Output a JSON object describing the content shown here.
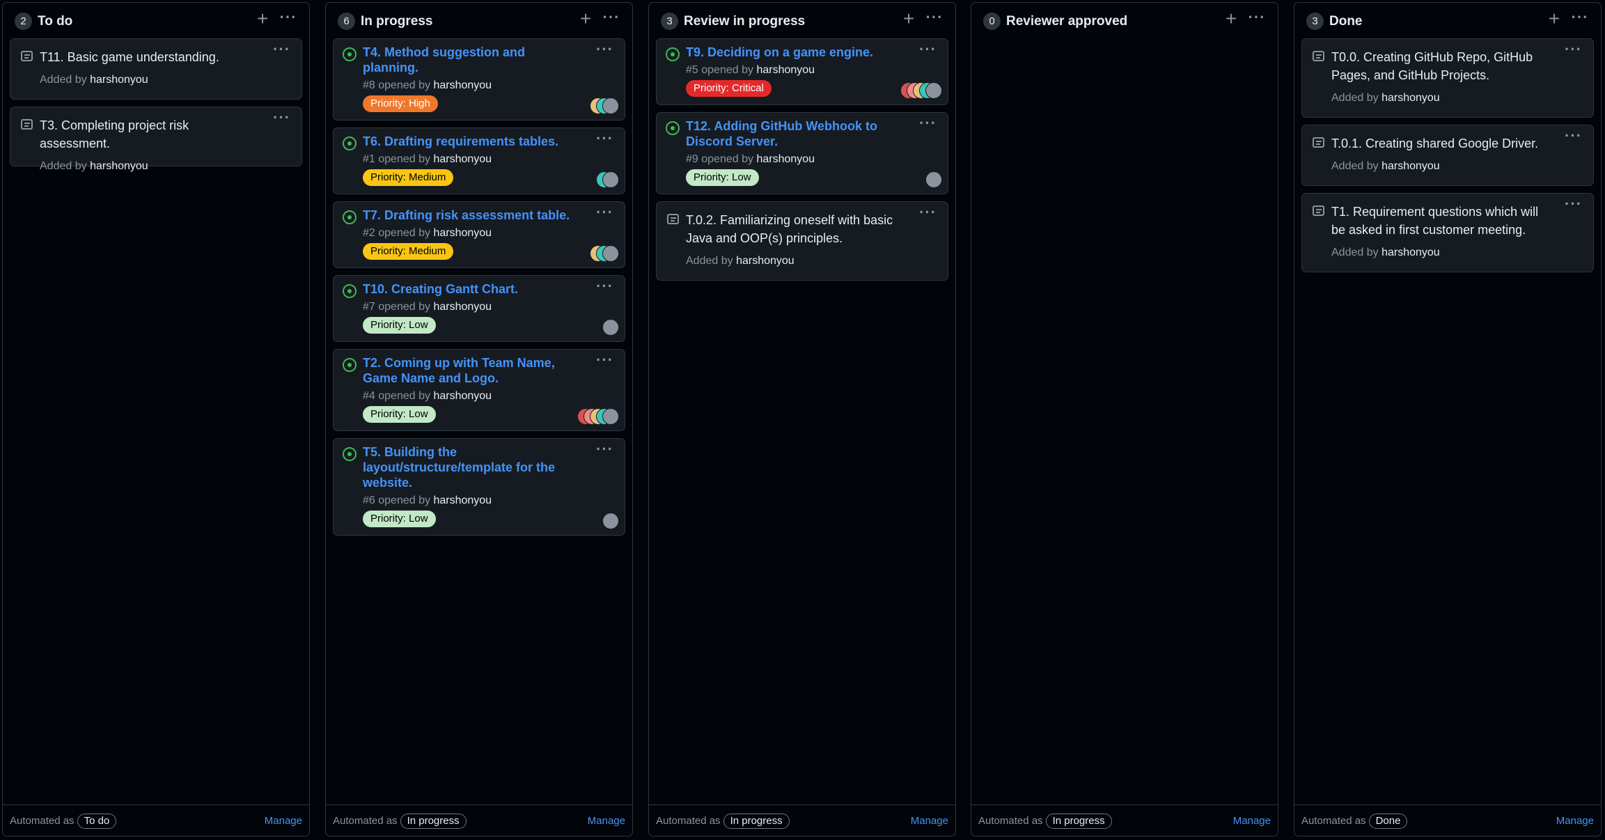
{
  "columns": [
    {
      "count": "2",
      "title": "To do",
      "footer": {
        "automated_prefix": "Automated as",
        "automated_value": "To do",
        "manage": "Manage"
      },
      "cards": [
        {
          "text": "T11. Basic game understanding.",
          "added_by_prefix": "Added by",
          "author": "harshonyou"
        },
        {
          "text": "T3. Completing project risk assessment.",
          "added_by_prefix": "Added by",
          "author": "harshonyou"
        }
      ]
    },
    {
      "count": "6",
      "title": "In progress",
      "footer": {
        "automated_prefix": "Automated as",
        "automated_value": "In progress",
        "manage": "Manage"
      },
      "issues": [
        {
          "title": "T4. Method suggestion and planning.",
          "number_text": "#8 opened by",
          "author": "harshonyou",
          "label": "Priority: High",
          "label_bg": "#f0782a",
          "label_fg": "#ffffff",
          "avatars": 3
        },
        {
          "title": "T6. Drafting requirements tables.",
          "number_text": "#1 opened by",
          "author": "harshonyou",
          "label": "Priority: Medium",
          "label_bg": "#f9c513",
          "label_fg": "#000000",
          "avatars": 2
        },
        {
          "title": "T7. Drafting risk assessment table.",
          "number_text": "#2 opened by",
          "author": "harshonyou",
          "label": "Priority: Medium",
          "label_bg": "#f9c513",
          "label_fg": "#000000",
          "avatars": 3
        },
        {
          "title": "T10. Creating Gantt Chart.",
          "number_text": "#7 opened by",
          "author": "harshonyou",
          "label": "Priority: Low",
          "label_bg": "#c2e8c6",
          "label_fg": "#000000",
          "avatars": 1
        },
        {
          "title": "T2. Coming up with Team Name, Game Name and Logo.",
          "number_text": "#4 opened by",
          "author": "harshonyou",
          "label": "Priority: Low",
          "label_bg": "#c2e8c6",
          "label_fg": "#000000",
          "avatars": 5
        },
        {
          "title": "T5. Building the layout/structure/template for the website.",
          "number_text": "#6 opened by",
          "author": "harshonyou",
          "label": "Priority: Low",
          "label_bg": "#c2e8c6",
          "label_fg": "#000000",
          "avatars": 1
        }
      ]
    },
    {
      "count": "3",
      "title": "Review in progress",
      "footer": {
        "automated_prefix": "Automated as",
        "automated_value": "In progress",
        "manage": "Manage"
      },
      "issues": [
        {
          "title": "T9. Deciding on a game engine.",
          "number_text": "#5 opened by",
          "author": "harshonyou",
          "label": "Priority: Critical",
          "label_bg": "#e5292b",
          "label_fg": "#ffffff",
          "avatars": 5
        },
        {
          "title": "T12. Adding GitHub Webhook to Discord Server.",
          "number_text": "#9 opened by",
          "author": "harshonyou",
          "label": "Priority: Low",
          "label_bg": "#c2e8c6",
          "label_fg": "#000000",
          "avatars": 1
        }
      ],
      "cards": [
        {
          "text": "T.0.2. Familiarizing oneself with basic Java and OOP(s) principles.",
          "added_by_prefix": "Added by",
          "author": "harshonyou"
        }
      ]
    },
    {
      "count": "0",
      "title": "Reviewer approved",
      "footer": {
        "automated_prefix": "Automated as",
        "automated_value": "In progress",
        "manage": "Manage"
      }
    },
    {
      "count": "3",
      "title": "Done",
      "footer": {
        "automated_prefix": "Automated as",
        "automated_value": "Done",
        "manage": "Manage"
      },
      "cards": [
        {
          "text": "T0.0. Creating GitHub Repo, GitHub Pages, and GitHub Projects.",
          "added_by_prefix": "Added by",
          "author": "harshonyou"
        },
        {
          "text": "T.0.1. Creating shared Google Driver.",
          "added_by_prefix": "Added by",
          "author": "harshonyou"
        },
        {
          "text": "T1. Requirement questions which will be asked in first customer meeting.",
          "added_by_prefix": "Added by",
          "author": "harshonyou"
        }
      ]
    }
  ],
  "icons": {
    "add": "plus-icon",
    "menu": "kebab-icon",
    "note": "note-icon",
    "issue": "open-issue-icon"
  },
  "colors": {
    "background": "#010409",
    "card": "#161b22",
    "border": "#30363d",
    "link": "#4493f8",
    "open_issue": "#3fb950"
  }
}
